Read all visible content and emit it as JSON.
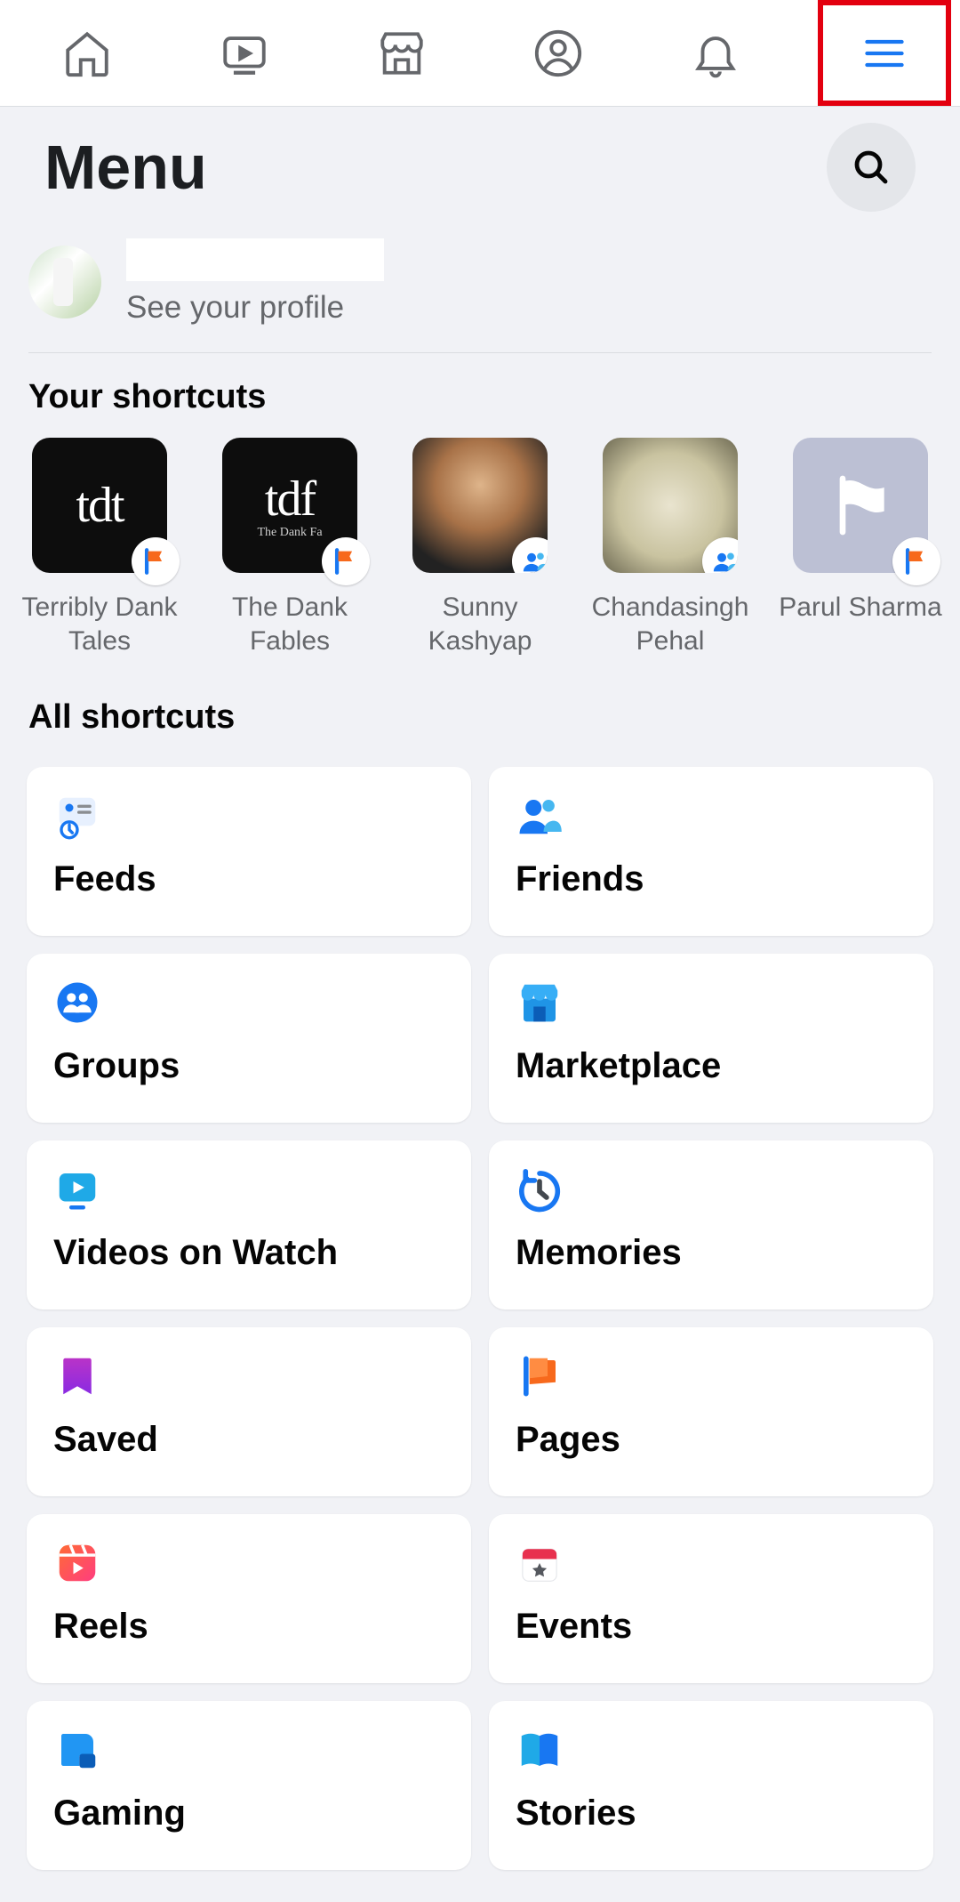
{
  "header": {
    "title": "Menu"
  },
  "profile": {
    "see_profile": "See your profile"
  },
  "sections": {
    "your_shortcuts": "Your shortcuts",
    "all_shortcuts": "All shortcuts"
  },
  "shortcuts": [
    {
      "label": "Terribly Dank Tales",
      "abbr": "tdt",
      "sub": "",
      "badge": "page"
    },
    {
      "label": "The Dank Fables",
      "abbr": "tdf",
      "sub": "The Dank Fa",
      "badge": "page"
    },
    {
      "label": "Sunny Kashyap",
      "abbr": "",
      "sub": "",
      "badge": "group"
    },
    {
      "label": "Chandasingh Pehal",
      "abbr": "",
      "sub": "",
      "badge": "group"
    },
    {
      "label": "Parul Sharma",
      "abbr": "",
      "sub": "",
      "badge": "page"
    }
  ],
  "tiles": [
    {
      "label": "Feeds"
    },
    {
      "label": "Friends"
    },
    {
      "label": "Groups"
    },
    {
      "label": "Marketplace"
    },
    {
      "label": "Videos on Watch"
    },
    {
      "label": "Memories"
    },
    {
      "label": "Saved"
    },
    {
      "label": "Pages"
    },
    {
      "label": "Reels"
    },
    {
      "label": "Events"
    },
    {
      "label": "Gaming"
    },
    {
      "label": "Stories"
    }
  ]
}
